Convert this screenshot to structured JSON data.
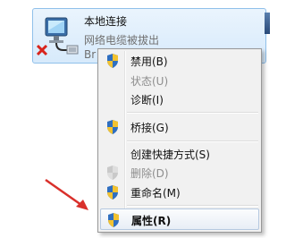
{
  "connection": {
    "name": "本地连接",
    "status": "网络电缆被拔出",
    "device": "Br"
  },
  "menu": {
    "items": [
      {
        "label": "禁用(B)",
        "shield": true,
        "disabled": false
      },
      {
        "label": "状态(U)",
        "shield": false,
        "disabled": true
      },
      {
        "label": "诊断(I)",
        "shield": false,
        "disabled": false
      },
      {
        "label": "桥接(G)",
        "shield": true,
        "disabled": false
      },
      {
        "label": "创建快捷方式(S)",
        "shield": false,
        "disabled": false
      },
      {
        "label": "删除(D)",
        "shield": true,
        "disabled": true
      },
      {
        "label": "重命名(M)",
        "shield": true,
        "disabled": false
      },
      {
        "label": "属性(R)",
        "shield": true,
        "disabled": false,
        "highlighted": true
      }
    ]
  },
  "colors": {
    "arrow": "#d9302b",
    "shield_blue": "#2f6fc0",
    "shield_yellow": "#f2c230",
    "error_x": "#d8241c"
  },
  "icons": {
    "connection": "network-adapter-icon",
    "error": "red-x-icon",
    "uac": "uac-shield-icon"
  }
}
